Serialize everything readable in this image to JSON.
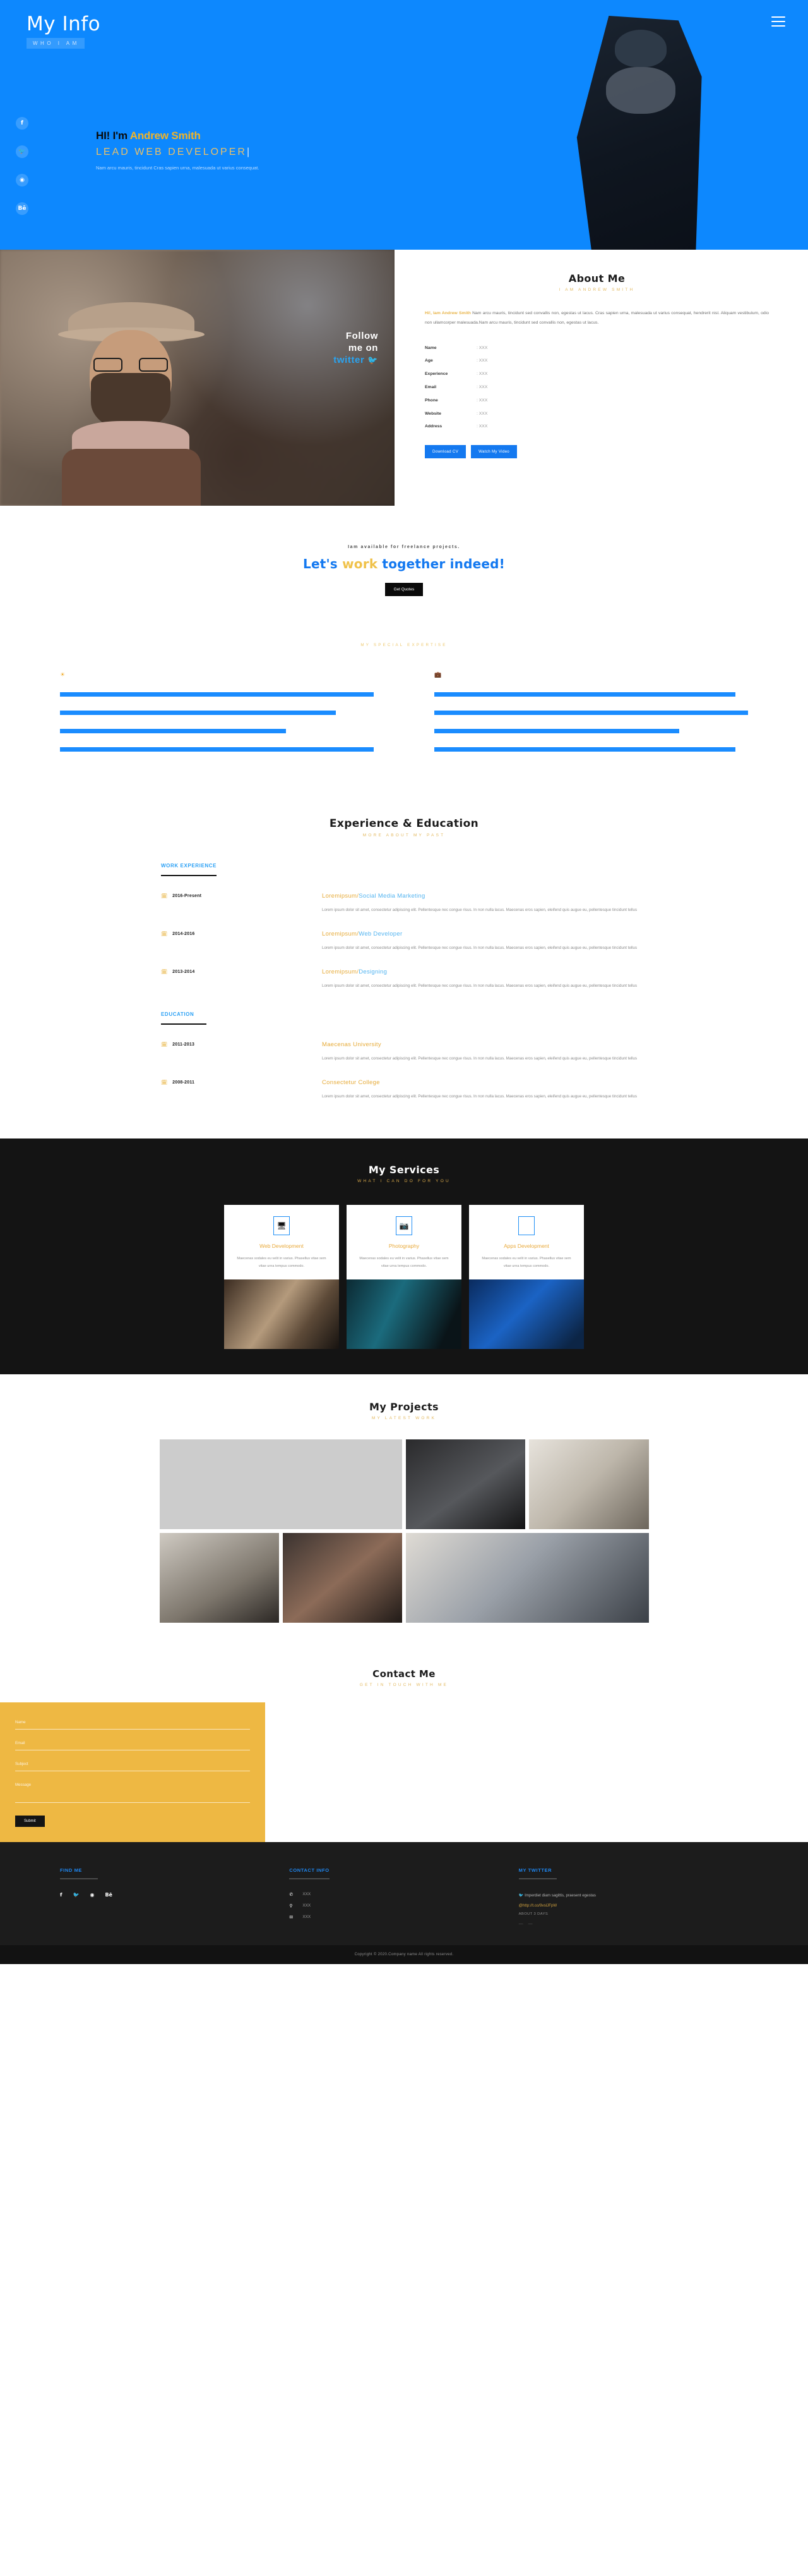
{
  "hero": {
    "brand": "My Info",
    "tagline": "WHO I AM",
    "greeting_prefix": "HI! I'm ",
    "name": "Andrew Smith",
    "role": "LEAD WEB DEVELOPER",
    "role_caret": "|",
    "description": "Nam arcu mauris, tincidunt Cras sapien urna, malesuada ut varius consequat.",
    "social": [
      {
        "name": "facebook-icon",
        "glyph": "f"
      },
      {
        "name": "twitter-icon",
        "glyph": "🐦"
      },
      {
        "name": "dribbble-icon",
        "glyph": "◉"
      },
      {
        "name": "behance-icon",
        "glyph": "Bē"
      }
    ]
  },
  "about": {
    "title": "About Me",
    "subtitle": "I AM ANDREW SMITH",
    "intro_highlight": "Hi!, Iam Andrew Smith",
    "intro_body": " Nam arcu mauris, tincidunt sed convallis non, egestas ut lacus. Cras sapien urna, malesuada ut varius consequat, hendrerit nisl. Aliquam vestibulum, odio non ullamcorper malesuada.Nam arcu mauris, tincidunt sed convallis non, egestas ut lacus.",
    "facts": [
      {
        "key": "Name",
        "value": ": XXX"
      },
      {
        "key": "Age",
        "value": ": XXX"
      },
      {
        "key": "Experience",
        "value": ": XXX"
      },
      {
        "key": "Email",
        "value": ": XXX"
      },
      {
        "key": "Phone",
        "value": ": XXX"
      },
      {
        "key": "Website",
        "value": ": XXX"
      },
      {
        "key": "Address",
        "value": ": XXX"
      }
    ],
    "btn_download": "Download CV",
    "btn_video": "Watch My Video",
    "follow_l1": "Follow",
    "follow_l2": "me on",
    "follow_l3": "twitter"
  },
  "cta": {
    "available": "Iam available for freelance projects.",
    "head_1": "Let's ",
    "head_work": "work",
    "head_2": " together indeed!",
    "button": "Get Quotes"
  },
  "expertise": {
    "subtitle": "MY SPECIAL EXPERTISE",
    "left_icon": "sun-icon",
    "right_icon": "briefcase-icon",
    "left_bars": [
      100,
      88,
      72,
      100
    ],
    "right_bars": [
      96,
      100,
      78,
      96
    ]
  },
  "resume": {
    "title": "Experience & Education",
    "subtitle": "MORE ABOUT MY PAST",
    "work_head": "WORK EXPERIENCE",
    "edu_head": "EDUCATION",
    "body_text": "Lorem ipsum dolor sit amet, consectetur adipiscing elit. Pellentesque nec congue risus. In non nulla lacus. Maecenas eros sapien, eleifend quis augue eu, pellentesque tincidunt tellus",
    "work": [
      {
        "date": "2016-Present",
        "org": "Loremipsum/",
        "role": "Social Media Marketing"
      },
      {
        "date": "2014-2016",
        "org": "Loremipsum/",
        "role": "Web Developer"
      },
      {
        "date": "2013-2014",
        "org": "Loremipsum/",
        "role": "Designing"
      }
    ],
    "education": [
      {
        "date": "2011-2013",
        "org": "Maecenas University",
        "role": ""
      },
      {
        "date": "2008-2011",
        "org": "Consectetur College",
        "role": ""
      }
    ]
  },
  "services": {
    "title": "My Services",
    "subtitle": "WHAT I CAN DO FOR YOU",
    "cards": [
      {
        "icon": "monitor-icon",
        "glyph": "🖥",
        "title": "Web Development",
        "desc": "Maecenas sodales eu velit in varius. Phasellus vitae sem vitae urna tempus commodo."
      },
      {
        "icon": "camera-icon",
        "glyph": "📷",
        "title": "Photography",
        "desc": "Maecenas sodales eu velit in varius. Phasellus vitae sem vitae urna tempus commodo."
      },
      {
        "icon": "apple-icon",
        "glyph": "",
        "title": "Apps Development",
        "desc": "Maecenas sodales eu velit in varius. Phasellus vitae sem vitae urna tempus commodo."
      }
    ]
  },
  "projects": {
    "title": "My Projects",
    "subtitle": "MY LATEST WORK"
  },
  "contact": {
    "title": "Contact Me",
    "subtitle": "GET IN TOUCH WITH ME",
    "fields": {
      "name": "Name",
      "email": "Email",
      "subject": "Subject",
      "message": "Message"
    },
    "submit": "Submit"
  },
  "footer": {
    "find_me": "FIND ME",
    "contact_info": "CONTACT INFO",
    "my_twitter": "MY TWITTER",
    "social": [
      {
        "name": "facebook-icon",
        "glyph": "f"
      },
      {
        "name": "twitter-icon",
        "glyph": "🐦"
      },
      {
        "name": "dribbble-icon",
        "glyph": "◉"
      },
      {
        "name": "behance-icon",
        "glyph": "Bē"
      }
    ],
    "contacts": [
      {
        "icon": "phone-icon",
        "glyph": "✆",
        "text": "XXX"
      },
      {
        "icon": "location-pin-icon",
        "glyph": "⚲",
        "text": "XXX"
      },
      {
        "icon": "envelope-icon",
        "glyph": "✉",
        "text": "XXX"
      }
    ],
    "tweet_text": "Imperdiet diam sagittis, praesent egestas",
    "tweet_link": "@http://t.co/9vslJFpW",
    "tweet_time": "ABOUT 3 DAYS",
    "copyright": "Copyright © 2020.Company name All rights reserved."
  },
  "colors": {
    "brand_blue": "#0d88fe",
    "accent_yellow": "#e8b54b",
    "dark": "#141414",
    "form_yellow": "#eeb843"
  }
}
